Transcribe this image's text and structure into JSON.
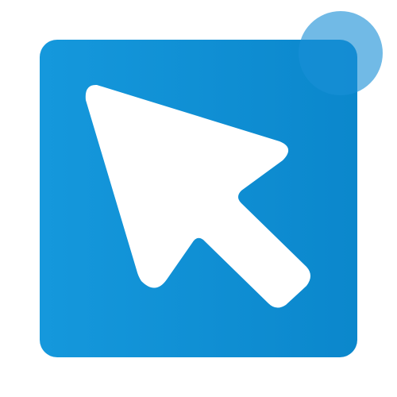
{
  "icon": {
    "name": "cursor-app-icon",
    "colors": {
      "tile_start": "#1598dc",
      "tile_end": "#0b87cc",
      "dot": "#1a8fd6",
      "cursor": "#ffffff"
    },
    "badge": {
      "name": "notification-dot",
      "visible": true
    }
  }
}
